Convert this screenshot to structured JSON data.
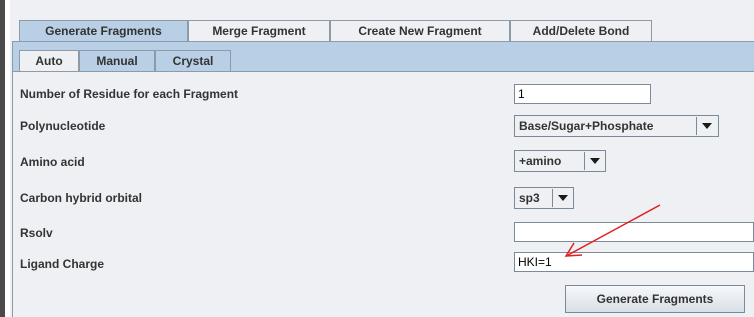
{
  "tabs": [
    {
      "label": "Generate Fragments",
      "selected": true
    },
    {
      "label": "Merge Fragment",
      "selected": false
    },
    {
      "label": "Create New Fragment",
      "selected": false
    },
    {
      "label": "Add/Delete Bond",
      "selected": false
    }
  ],
  "subtabs": [
    {
      "label": "Auto",
      "selected": true
    },
    {
      "label": "Manual",
      "selected": false
    },
    {
      "label": "Crystal",
      "selected": false
    }
  ],
  "form": {
    "residue_label": "Number of Residue for each Fragment",
    "residue_value": "1",
    "polynucleotide_label": "Polynucleotide",
    "polynucleotide_value": "Base/Sugar+Phosphate",
    "amino_label": "Amino acid",
    "amino_value": "+amino",
    "carbon_label": "Carbon hybrid orbital",
    "carbon_value": "sp3",
    "rsolv_label": "Rsolv",
    "rsolv_value": "",
    "ligand_label": "Ligand Charge",
    "ligand_value": "HKI=1"
  },
  "button": {
    "label": "Generate Fragments"
  },
  "colors": {
    "selected_tab": "#b8cfe5",
    "panel": "#eef0f4",
    "annotation_arrow": "#e02020"
  },
  "icons": {
    "combo_arrow": "chevron-down-icon"
  }
}
